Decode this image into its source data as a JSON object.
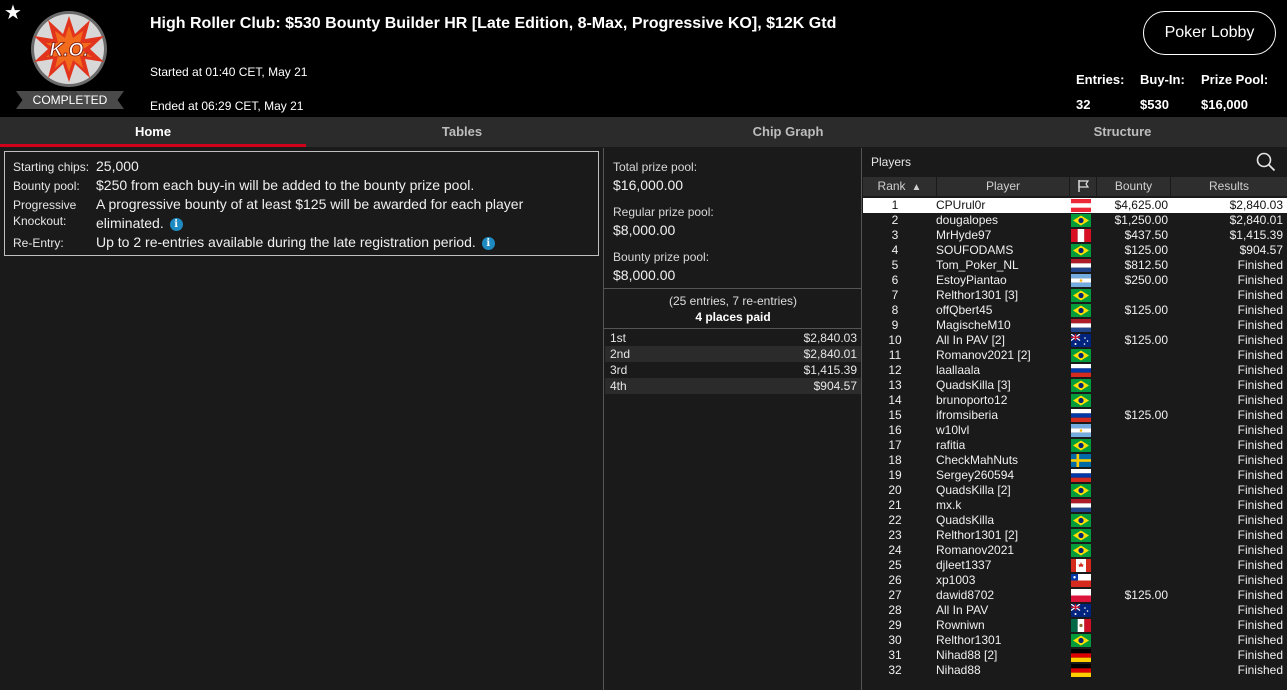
{
  "header": {
    "star": "★",
    "logo_text": "K.O.",
    "status_badge": "COMPLETED",
    "title": "High Roller Club: $530 Bounty Builder HR [Late Edition, 8-Max, Progressive KO], $12K Gtd",
    "started": "Started at 01:40 CET, May 21",
    "ended": "Ended at 06:29 CET, May 21",
    "lobby_button": "Poker Lobby",
    "stats": {
      "entries_label": "Entries:",
      "entries_value": "32",
      "buyin_label": "Buy-In:",
      "buyin_value": "$530",
      "prizepool_label": "Prize Pool:",
      "prizepool_value": "$16,000"
    }
  },
  "tabs": [
    "Home",
    "Tables",
    "Chip Graph",
    "Structure"
  ],
  "info": {
    "starting_chips_label": "Starting chips:",
    "starting_chips_value": "25,000",
    "bounty_pool_label": "Bounty pool:",
    "bounty_pool_value": "$250 from each buy-in will be added to the bounty prize pool.",
    "pk_label_1": "Progressive",
    "pk_label_2": "Knockout:",
    "pk_value_1": "A progressive bounty of at least $125 will be awarded for each player",
    "pk_value_2": "eliminated.",
    "reentry_label": "Re-Entry:",
    "reentry_value": "Up to 2 re-entries available during the late registration period."
  },
  "prize": {
    "total_label": "Total prize pool:",
    "total_value": "$16,000.00",
    "regular_label": "Regular prize pool:",
    "regular_value": "$8,000.00",
    "bounty_label": "Bounty prize pool:",
    "bounty_value": "$8,000.00",
    "entries_note": "(25 entries, 7 re-entries)",
    "places_paid": "4 places paid",
    "payouts": [
      {
        "place": "1st",
        "amount": "$2,840.03"
      },
      {
        "place": "2nd",
        "amount": "$2,840.01"
      },
      {
        "place": "3rd",
        "amount": "$1,415.39"
      },
      {
        "place": "4th",
        "amount": "$904.57"
      }
    ]
  },
  "players": {
    "title": "Players",
    "columns": {
      "rank": "Rank",
      "player": "Player",
      "bounty": "Bounty",
      "results": "Results"
    },
    "rows": [
      {
        "rank": "1",
        "name": "CPUrul0r",
        "flag": "austria",
        "bounty": "$4,625.00",
        "result": "$2,840.03"
      },
      {
        "rank": "2",
        "name": "dougalopes",
        "flag": "brazil",
        "bounty": "$1,250.00",
        "result": "$2,840.01"
      },
      {
        "rank": "3",
        "name": "MrHyde97",
        "flag": "peru",
        "bounty": "$437.50",
        "result": "$1,415.39"
      },
      {
        "rank": "4",
        "name": "SOUFODAMS",
        "flag": "brazil",
        "bounty": "$125.00",
        "result": "$904.57"
      },
      {
        "rank": "5",
        "name": "Tom_Poker_NL",
        "flag": "netherlands",
        "bounty": "$812.50",
        "result": "Finished"
      },
      {
        "rank": "6",
        "name": "EstoyPiantao",
        "flag": "argentina",
        "bounty": "$250.00",
        "result": "Finished"
      },
      {
        "rank": "7",
        "name": "Relthor1301 [3]",
        "flag": "brazil",
        "bounty": "",
        "result": "Finished"
      },
      {
        "rank": "8",
        "name": "offQbert45",
        "flag": "brazil",
        "bounty": "$125.00",
        "result": "Finished"
      },
      {
        "rank": "9",
        "name": "MagischeM10",
        "flag": "netherlands",
        "bounty": "",
        "result": "Finished"
      },
      {
        "rank": "10",
        "name": "All In PAV [2]",
        "flag": "australia",
        "bounty": "$125.00",
        "result": "Finished"
      },
      {
        "rank": "11",
        "name": "Romanov2021 [2]",
        "flag": "brazil",
        "bounty": "",
        "result": "Finished"
      },
      {
        "rank": "12",
        "name": "laallaala",
        "flag": "russia",
        "bounty": "",
        "result": "Finished"
      },
      {
        "rank": "13",
        "name": "QuadsKilla [3]",
        "flag": "brazil",
        "bounty": "",
        "result": "Finished"
      },
      {
        "rank": "14",
        "name": "brunoporto12",
        "flag": "brazil",
        "bounty": "",
        "result": "Finished"
      },
      {
        "rank": "15",
        "name": "ifromsiberia",
        "flag": "russia",
        "bounty": "$125.00",
        "result": "Finished"
      },
      {
        "rank": "16",
        "name": "w10lvl",
        "flag": "argentina",
        "bounty": "",
        "result": "Finished"
      },
      {
        "rank": "17",
        "name": "rafitia",
        "flag": "brazil",
        "bounty": "",
        "result": "Finished"
      },
      {
        "rank": "18",
        "name": "CheckMahNuts",
        "flag": "sweden",
        "bounty": "",
        "result": "Finished"
      },
      {
        "rank": "19",
        "name": "Sergey260594",
        "flag": "russia",
        "bounty": "",
        "result": "Finished"
      },
      {
        "rank": "20",
        "name": "QuadsKilla [2]",
        "flag": "brazil",
        "bounty": "",
        "result": "Finished"
      },
      {
        "rank": "21",
        "name": "mx.k",
        "flag": "netherlands",
        "bounty": "",
        "result": "Finished"
      },
      {
        "rank": "22",
        "name": "QuadsKilla",
        "flag": "brazil",
        "bounty": "",
        "result": "Finished"
      },
      {
        "rank": "23",
        "name": "Relthor1301 [2]",
        "flag": "brazil",
        "bounty": "",
        "result": "Finished"
      },
      {
        "rank": "24",
        "name": "Romanov2021",
        "flag": "brazil",
        "bounty": "",
        "result": "Finished"
      },
      {
        "rank": "25",
        "name": "djleet1337",
        "flag": "canada",
        "bounty": "",
        "result": "Finished"
      },
      {
        "rank": "26",
        "name": "xp1003",
        "flag": "chile",
        "bounty": "",
        "result": "Finished"
      },
      {
        "rank": "27",
        "name": "dawid8702",
        "flag": "poland",
        "bounty": "$125.00",
        "result": "Finished"
      },
      {
        "rank": "28",
        "name": "All In PAV",
        "flag": "australia",
        "bounty": "",
        "result": "Finished"
      },
      {
        "rank": "29",
        "name": "Rowniwn",
        "flag": "mexico",
        "bounty": "",
        "result": "Finished"
      },
      {
        "rank": "30",
        "name": "Relthor1301",
        "flag": "brazil",
        "bounty": "",
        "result": "Finished"
      },
      {
        "rank": "31",
        "name": "Nihad88 [2]",
        "flag": "germany",
        "bounty": "",
        "result": "Finished"
      },
      {
        "rank": "32",
        "name": "Nihad88",
        "flag": "germany",
        "bounty": "",
        "result": "Finished"
      }
    ]
  },
  "colors": {
    "accent": "#d0021b",
    "info_icon": "#1e8ac2",
    "header_bg": "#000000",
    "panel_bg": "#1a1a1a"
  }
}
